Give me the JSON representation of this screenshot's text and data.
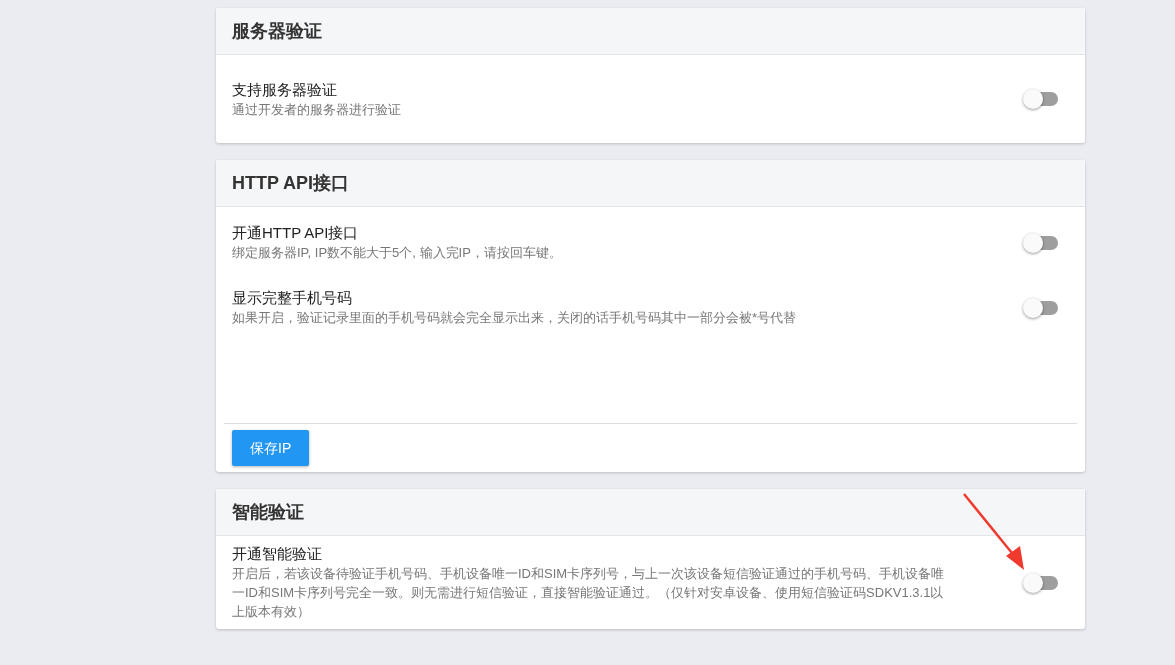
{
  "sections": [
    {
      "title": "服务器验证",
      "settings": [
        {
          "label": "支持服务器验证",
          "description": "通过开发者的服务器进行验证",
          "on": false
        }
      ]
    },
    {
      "title": "HTTP API接口",
      "settings": [
        {
          "label": "开通HTTP API接口",
          "description": "绑定服务器IP, IP数不能大于5个, 输入完IP，请按回车键。",
          "on": false
        },
        {
          "label": "显示完整手机号码",
          "description": "如果开启，验证记录里面的手机号码就会完全显示出来，关闭的话手机号码其中一部分会被*号代替",
          "on": false
        }
      ],
      "button": "保存IP"
    },
    {
      "title": "智能验证",
      "settings": [
        {
          "label": "开通智能验证",
          "description": "开启后，若该设备待验证手机号码、手机设备唯一ID和SIM卡序列号，与上一次该设备短信验证通过的手机号码、手机设备唯一ID和SIM卡序列号完全一致。则无需进行短信验证，直接智能验证通过。（仅针对安卓设备、使用短信验证码SDKV1.3.1以上版本有效）",
          "on": false
        }
      ]
    }
  ]
}
